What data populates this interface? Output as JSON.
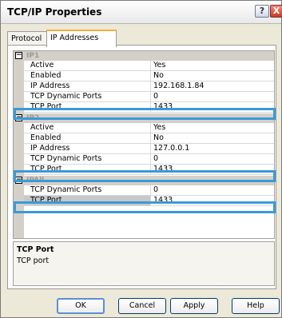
{
  "window": {
    "title": "TCP/IP Properties",
    "help_glyph": "?",
    "close_glyph": "X"
  },
  "tabs": [
    {
      "label": "Protocol",
      "active": false
    },
    {
      "label": "IP Addresses",
      "active": true
    }
  ],
  "grid": {
    "collapse_glyph": "−",
    "categories": [
      {
        "name": "IP1",
        "rows": [
          {
            "key": "Active",
            "value": "Yes"
          },
          {
            "key": "Enabled",
            "value": "No"
          },
          {
            "key": "IP Address",
            "value": "192.168.1.84"
          },
          {
            "key": "TCP Dynamic Ports",
            "value": "0"
          },
          {
            "key": "TCP Port",
            "value": "1433"
          }
        ]
      },
      {
        "name": "IP2",
        "rows": [
          {
            "key": "Active",
            "value": "Yes"
          },
          {
            "key": "Enabled",
            "value": "No"
          },
          {
            "key": "IP Address",
            "value": "127.0.0.1"
          },
          {
            "key": "TCP Dynamic Ports",
            "value": "0"
          },
          {
            "key": "TCP Port",
            "value": "1433"
          }
        ]
      },
      {
        "name": "IPAll",
        "rows": [
          {
            "key": "TCP Dynamic Ports",
            "value": "0"
          },
          {
            "key": "TCP Port",
            "value": "1433"
          }
        ]
      }
    ]
  },
  "description": {
    "title": "TCP Port",
    "text": "TCP port"
  },
  "buttons": {
    "ok": "OK",
    "cancel": "Cancel",
    "apply": "Apply",
    "help": "Help"
  },
  "colors": {
    "highlight": "#3a9ad9"
  }
}
